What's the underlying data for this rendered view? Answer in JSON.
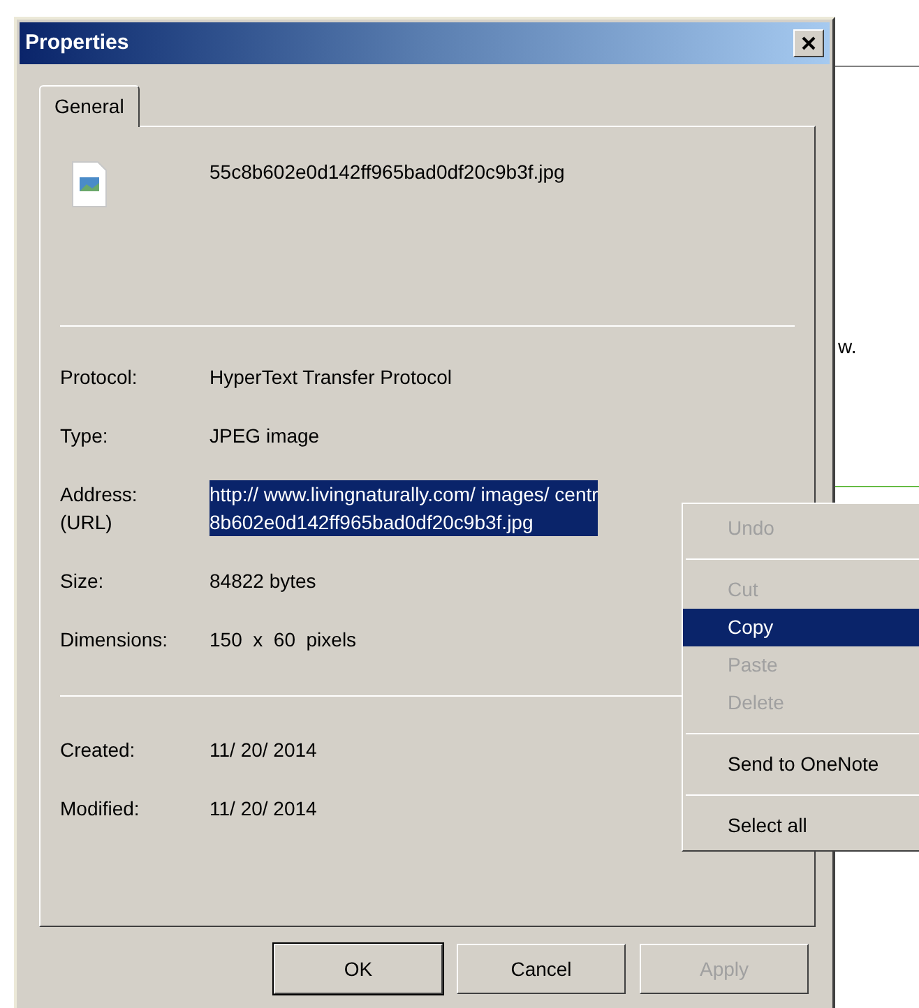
{
  "background": {
    "text": "w."
  },
  "window": {
    "title": "Properties"
  },
  "tabs": [
    {
      "label": "General",
      "selected": true
    }
  ],
  "file": {
    "name": "55c8b602e0d142ff965bad0df20c9b3f.jpg"
  },
  "details": [
    {
      "label": "Protocol:",
      "value": "HyperText Transfer Protocol"
    },
    {
      "label": "Type:",
      "value": "JPEG image"
    },
    {
      "label": "Address:\n(URL)",
      "value": "http:// www.livingnaturally.com/ images/ centr\n8b602e0d142ff965bad0df20c9b3f.jpg",
      "selected": true
    },
    {
      "label": "Size:",
      "value": "84822 bytes"
    },
    {
      "label": "Dimensions:",
      "value": "150  x  60  pixels"
    }
  ],
  "dates": [
    {
      "label": "Created:",
      "value": "11/ 20/ 2014"
    },
    {
      "label": "Modified:",
      "value": "11/ 20/ 2014"
    }
  ],
  "buttons": [
    {
      "label": "OK",
      "default": true,
      "disabled": false
    },
    {
      "label": "Cancel",
      "default": false,
      "disabled": false
    },
    {
      "label": "Apply",
      "default": false,
      "disabled": true
    }
  ],
  "context_menu": [
    {
      "kind": "item",
      "label": "Undo",
      "disabled": true,
      "selected": false
    },
    {
      "kind": "separator"
    },
    {
      "kind": "item",
      "label": "Cut",
      "disabled": true,
      "selected": false
    },
    {
      "kind": "item",
      "label": "Copy",
      "disabled": false,
      "selected": true
    },
    {
      "kind": "item",
      "label": "Paste",
      "disabled": true,
      "selected": false
    },
    {
      "kind": "item",
      "label": "Delete",
      "disabled": true,
      "selected": false
    },
    {
      "kind": "separator"
    },
    {
      "kind": "item",
      "label": "Send to OneNote",
      "disabled": false,
      "selected": false
    },
    {
      "kind": "separator"
    },
    {
      "kind": "item",
      "label": "Select all",
      "disabled": false,
      "selected": false
    }
  ]
}
